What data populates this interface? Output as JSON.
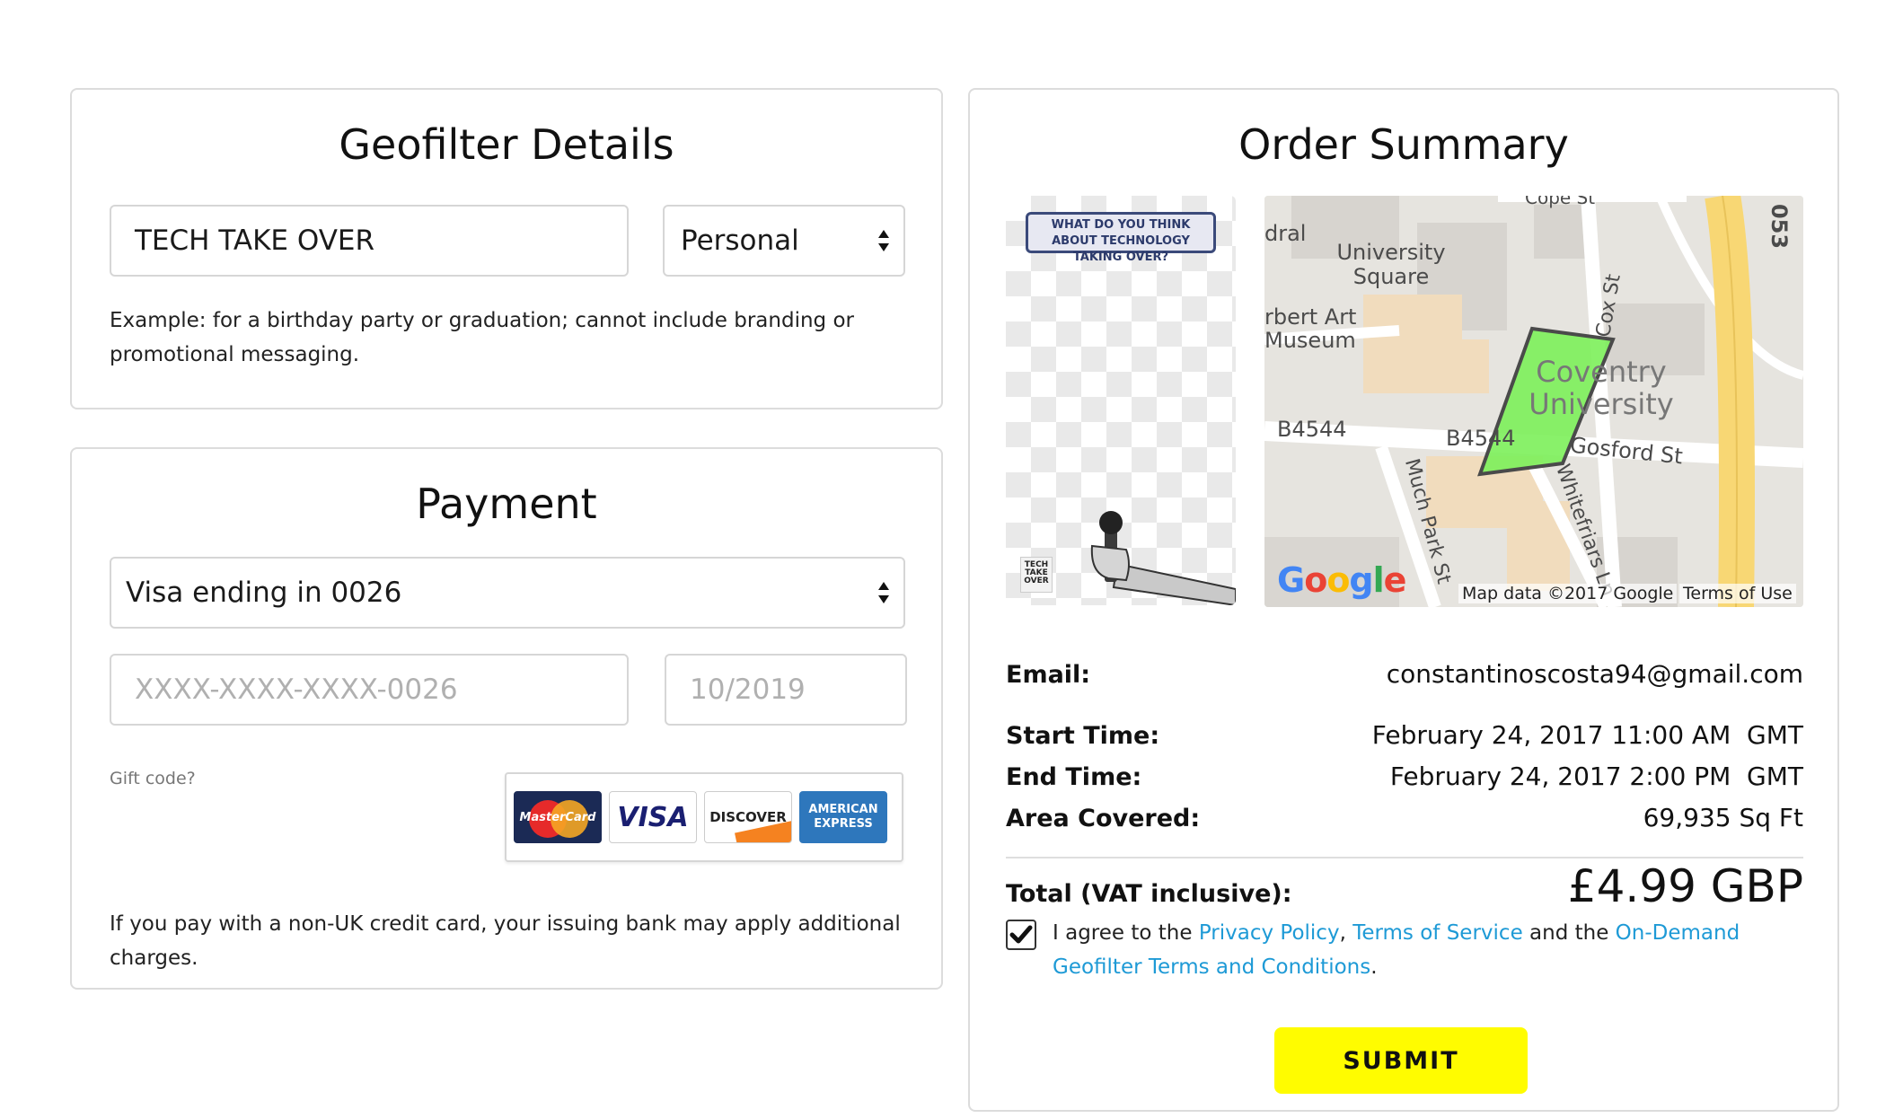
{
  "geofilter": {
    "title": "Geofilter Details",
    "name_value": "TECH TAKE OVER",
    "type_value": "Personal",
    "type_arrows_icon": "select-arrows-icon",
    "example_text": "Example: for a birthday party or graduation; cannot include branding or promotional messaging."
  },
  "payment": {
    "title": "Payment",
    "card_select_value": "Visa ending in 0026",
    "card_number_placeholder": "XXXX-XXXX-XXXX-0026",
    "expiry_placeholder": "10/2019",
    "gift_code_link": "Gift code?",
    "card_brands": [
      "MasterCard",
      "VISA",
      "DISCOVER",
      "AMERICAN EXPRESS"
    ],
    "notice": "If you pay with a non-UK credit card, your issuing bank may apply additional charges."
  },
  "summary": {
    "title": "Order Summary",
    "preview": {
      "banner_text": "WHAT DO YOU THINK ABOUT TECHNOLOGY TAKING OVER?",
      "logo_text": "TECH TAKE OVER"
    },
    "map": {
      "labels": [
        "Cope St",
        "053",
        "dral",
        "University Square",
        "rbert Art Museum",
        "Cox St",
        "Coventry University",
        "B4544",
        "B4544",
        "Gosford St",
        "Much Park St",
        "Whitefriars Ln"
      ],
      "google_logo": "Google",
      "attribution": "Map data ©2017 Google",
      "terms": "Terms of Use",
      "geofence_color": "#7cf05a"
    },
    "email_label": "Email:",
    "email_value": "constantinoscosta94@gmail.com",
    "start_label": "Start Time:",
    "start_value": "February 24, 2017 11:00 AM  GMT",
    "end_label": "End Time:",
    "end_value": "February 24, 2017 2:00 PM  GMT",
    "area_label": "Area Covered:",
    "area_value": "69,935 Sq Ft",
    "total_label": "Total (VAT inclusive):",
    "total_value": "£4.99 GBP",
    "agree": {
      "checked": true,
      "prefix": "I agree to the ",
      "privacy": "Privacy Policy",
      "comma": ", ",
      "terms": "Terms of Service",
      "and_the": " and the ",
      "ondemand": "On-Demand Geofilter Terms and Conditions",
      "period": "."
    },
    "submit_label": "SUBMIT"
  },
  "colors": {
    "accent_yellow": "#fffc00",
    "link_blue": "#1e9ad6",
    "border_gray": "#dcdcdc"
  }
}
